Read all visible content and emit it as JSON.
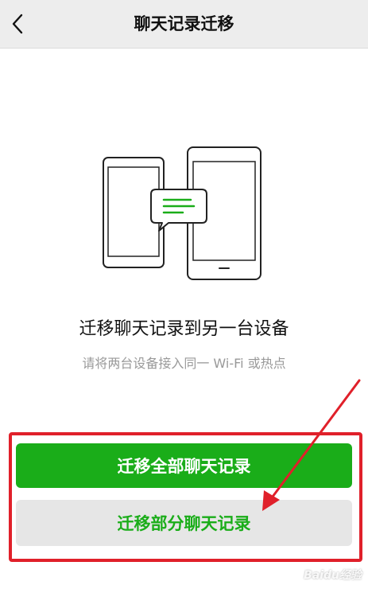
{
  "nav": {
    "title": "聊天记录迁移",
    "back_icon": "chevron-left-icon"
  },
  "main": {
    "headline": "迁移聊天记录到另一台设备",
    "subline": "请将两台设备接入同一 Wi-Fi 或热点",
    "illustration_icon": "phone-to-tablet-transfer-icon"
  },
  "actions": {
    "migrate_all_label": "迁移全部聊天记录",
    "migrate_partial_label": "迁移部分聊天记录"
  },
  "annotation": {
    "highlight_color": "#e0202a"
  },
  "watermark": {
    "text": "Baidu经验"
  },
  "colors": {
    "accent": "#1aad19",
    "nav_background": "#ededed",
    "secondary_button": "#e6e6e6"
  }
}
